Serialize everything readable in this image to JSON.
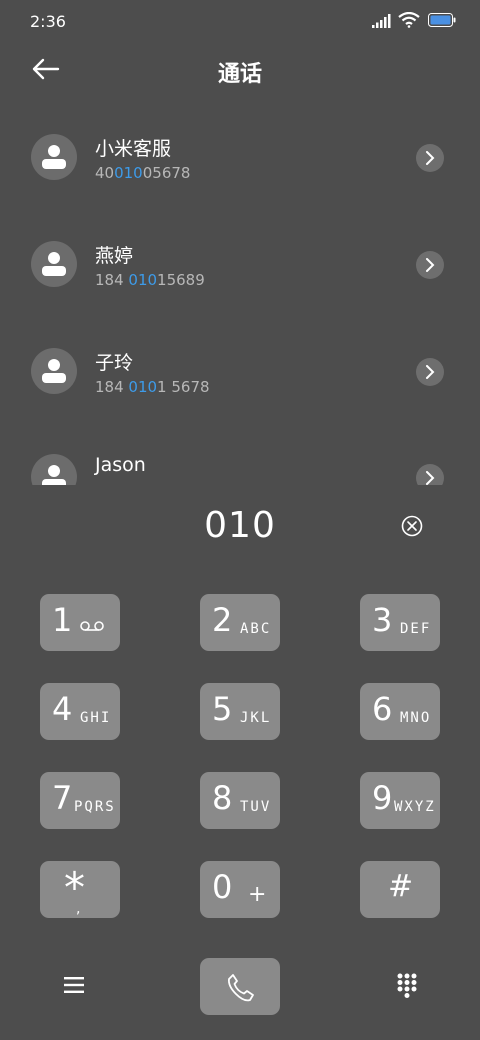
{
  "status": {
    "time": "2:36"
  },
  "header": {
    "title": "通话"
  },
  "results": [
    {
      "name": "小米客服",
      "number_parts": [
        "40",
        "010",
        "05678"
      ]
    },
    {
      "name": "燕婷",
      "number_parts": [
        "184 ",
        "010",
        "15689"
      ]
    },
    {
      "name": "子玲",
      "number_parts": [
        "184 ",
        "010",
        "1 5678"
      ]
    },
    {
      "name": "Jason",
      "number_parts": [
        "",
        "",
        ""
      ]
    }
  ],
  "dial": {
    "number": "010"
  },
  "keypad": [
    {
      "digit": "1",
      "letters": ""
    },
    {
      "digit": "2",
      "letters": "ABC"
    },
    {
      "digit": "3",
      "letters": "DEF"
    },
    {
      "digit": "4",
      "letters": "GHI"
    },
    {
      "digit": "5",
      "letters": "JKL"
    },
    {
      "digit": "6",
      "letters": "MNO"
    },
    {
      "digit": "7",
      "letters": "PQRS"
    },
    {
      "digit": "8",
      "letters": "TUV"
    },
    {
      "digit": "9",
      "letters": "WXYZ"
    },
    {
      "digit": "*",
      "letters": ","
    },
    {
      "digit": "0",
      "letters": "+"
    },
    {
      "digit": "#",
      "letters": ""
    }
  ],
  "colors": {
    "background": "#4d4d4d",
    "key": "#8a8a8a",
    "highlight": "#3d9be9",
    "battery": "#4a90e2"
  },
  "icons": {
    "back": "arrow-left-icon",
    "avatar": "person-icon",
    "chevron": "chevron-right-icon",
    "clear": "clear-circle-icon",
    "voicemail": "voicemail-icon",
    "menu": "hamburger-menu-icon",
    "call": "phone-icon",
    "dialpad": "dialpad-icon"
  }
}
